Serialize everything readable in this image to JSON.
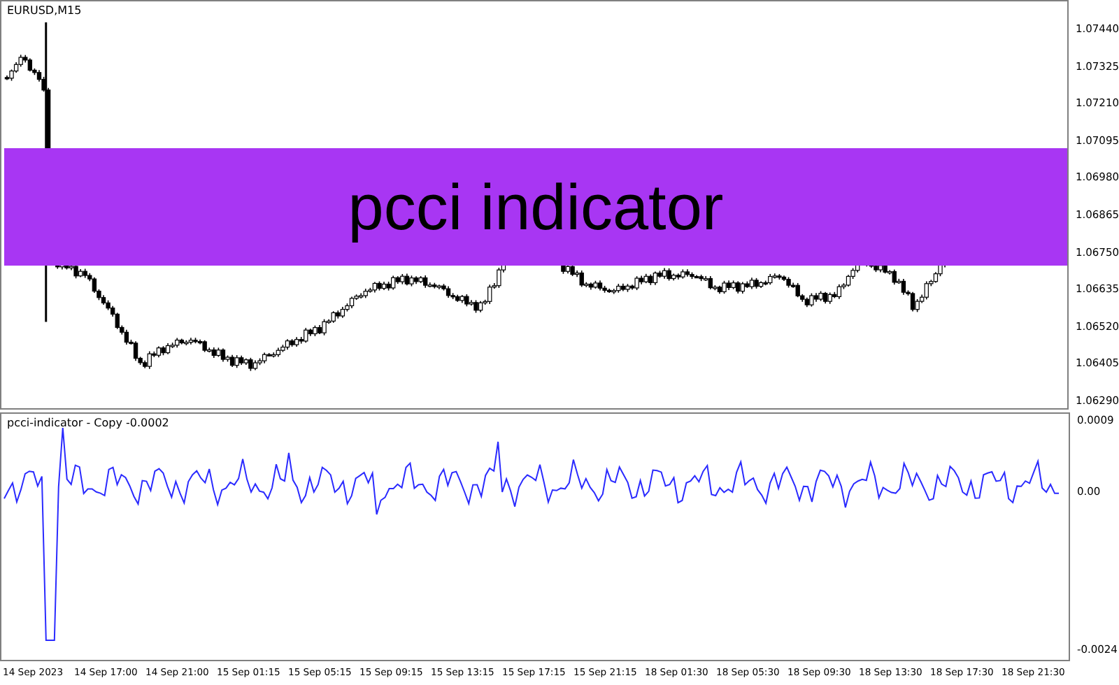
{
  "chart": {
    "symbol_label": "EURUSD,M15",
    "price_axis": [
      "1.07440",
      "1.07325",
      "1.07210",
      "1.07095",
      "1.06980",
      "1.06865",
      "1.06750",
      "1.06635",
      "1.06520",
      "1.06405",
      "1.06290"
    ]
  },
  "banner": {
    "title": "pcci indicator"
  },
  "indicator": {
    "label": "pcci-indicator - Copy -0.0002",
    "axis": [
      "0.0009",
      "0.00",
      "-0.0024"
    ]
  },
  "time_axis": [
    "14 Sep 2023",
    "14 Sep 17:00",
    "14 Sep 21:00",
    "15 Sep 01:15",
    "15 Sep 05:15",
    "15 Sep 09:15",
    "15 Sep 13:15",
    "15 Sep 17:15",
    "15 Sep 21:15",
    "18 Sep 01:30",
    "18 Sep 05:30",
    "18 Sep 09:30",
    "18 Sep 13:30",
    "18 Sep 17:30",
    "18 Sep 21:30"
  ]
}
